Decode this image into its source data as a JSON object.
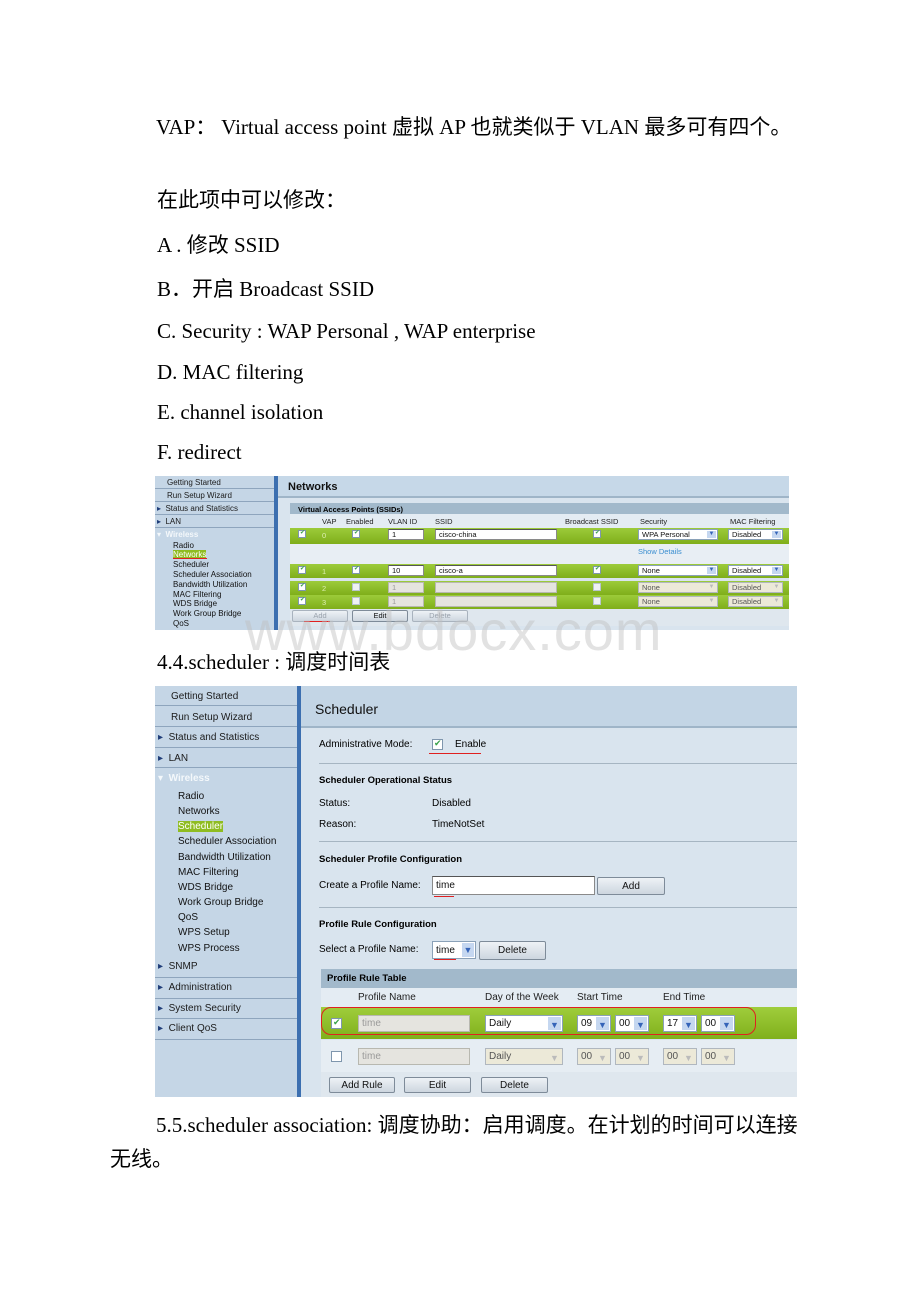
{
  "doc": {
    "intro": "VAP： Virtual access point 虚拟 AP 也就类似于 VLAN 最多可有四个。",
    "can_modify": "在此项中可以修改：",
    "items": [
      "A . 修改 SSID",
      "B．开启 Broadcast SSID",
      "C. Security : WAP Personal , WAP enterprise",
      "D. MAC filtering",
      "E. channel isolation",
      "F. redirect"
    ],
    "section_scheduler": "4.4.scheduler : 调度时间表",
    "section_assoc": "5.5.scheduler association: 调度协助：启用调度。在计划的时间可以连接无线。",
    "watermark": "www.bdocx.com"
  },
  "nav": {
    "top": [
      "Getting Started",
      "Run Setup Wizard",
      "Status and Statistics",
      "LAN"
    ],
    "wireless": "Wireless",
    "wireless_sub": [
      "Radio",
      "Networks",
      "Scheduler",
      "Scheduler Association",
      "Bandwidth Utilization",
      "MAC Filtering",
      "WDS Bridge",
      "Work Group Bridge",
      "QoS",
      "WPS Setup",
      "WPS Process"
    ],
    "bottom": [
      "SNMP",
      "Administration",
      "System Security",
      "Client QoS"
    ]
  },
  "networks": {
    "title": "Networks",
    "table_title": "Virtual Access Points (SSIDs)",
    "columns": [
      "",
      "VAP",
      "Enabled",
      "VLAN ID",
      "SSID",
      "Broadcast SSID",
      "Security",
      "MAC Filtering"
    ],
    "rows": [
      {
        "checked": true,
        "vap": "0",
        "enabled": true,
        "vlan": "1",
        "ssid": "cisco-china",
        "broadcast": true,
        "security": "WPA Personal",
        "mac": "Disabled",
        "disabled": false
      },
      {
        "checked": true,
        "vap": "1",
        "enabled": true,
        "vlan": "10",
        "ssid": "cisco-a",
        "broadcast": true,
        "security": "None",
        "mac": "Disabled",
        "disabled": false
      },
      {
        "checked": true,
        "vap": "2",
        "enabled": false,
        "vlan": "1",
        "ssid": "",
        "broadcast": false,
        "security": "None",
        "mac": "Disabled",
        "disabled": true
      },
      {
        "checked": true,
        "vap": "3",
        "enabled": false,
        "vlan": "1",
        "ssid": "",
        "broadcast": false,
        "security": "None",
        "mac": "Disabled",
        "disabled": true
      }
    ],
    "show_details": "Show Details",
    "buttons": {
      "add": "Add",
      "edit": "Edit",
      "delete": "Delete"
    }
  },
  "scheduler": {
    "title": "Scheduler",
    "admin_mode_label": "Administrative Mode:",
    "admin_mode_value": "Enable",
    "admin_mode_checked": true,
    "op_status_heading": "Scheduler Operational Status",
    "status_label": "Status:",
    "status_value": "Disabled",
    "reason_label": "Reason:",
    "reason_value": "TimeNotSet",
    "profile_config_heading": "Scheduler Profile Configuration",
    "create_label": "Create a Profile Name:",
    "create_value": "time",
    "add_label": "Add",
    "rule_config_heading": "Profile Rule Configuration",
    "select_label": "Select a Profile Name:",
    "select_value": "time",
    "delete_label": "Delete",
    "rule_table_title": "Profile Rule Table",
    "columns": [
      "",
      "Profile Name",
      "Day of the Week",
      "Start Time",
      "End Time"
    ],
    "rows": [
      {
        "checked": true,
        "profile": "time",
        "day": "Daily",
        "start_h": "09",
        "start_m": "00",
        "end_h": "17",
        "end_m": "00"
      },
      {
        "checked": false,
        "profile": "time",
        "day": "Daily",
        "start_h": "00",
        "start_m": "00",
        "end_h": "00",
        "end_m": "00"
      }
    ],
    "buttons": {
      "add_rule": "Add Rule",
      "edit": "Edit",
      "delete": "Delete"
    }
  },
  "colors": {
    "accent_green": "#8fbc21",
    "nav_blue": "#3c6fb0",
    "panel": "#d9e4ee",
    "header": "#a2b9cb"
  }
}
